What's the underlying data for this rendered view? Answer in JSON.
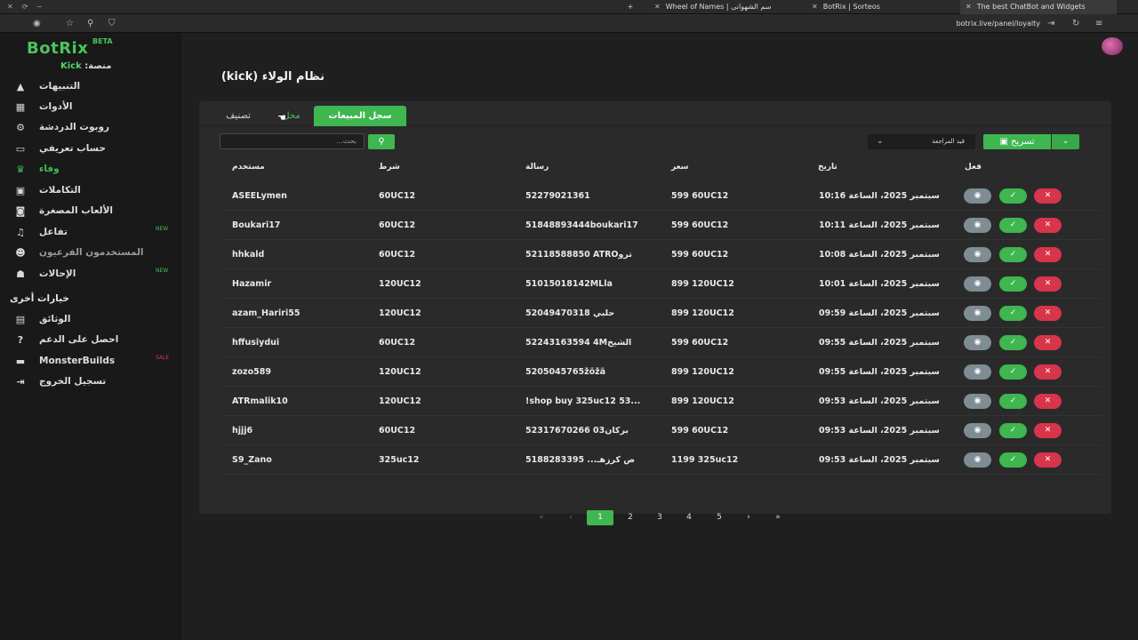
{
  "browser": {
    "tabs": [
      {
        "title": "The best ChatBot and Widgets",
        "active": true
      },
      {
        "title": "BotRix | Sorteos",
        "active": false
      },
      {
        "title": "Wheel of Names | سم الشهوانى",
        "active": false
      }
    ],
    "url": "botrix.live/panel/loyalty"
  },
  "sidebar": {
    "brand": "BotRix",
    "beta": "BETA",
    "platform_label": "منصة:",
    "platform_value": "Kick",
    "items": [
      {
        "label": "التنبيهات",
        "icon": "warning-icon"
      },
      {
        "label": "الأدوات",
        "icon": "tools-icon"
      },
      {
        "label": "روبوت الدردشة",
        "icon": "robot-icon"
      },
      {
        "label": "حساب تعريفي",
        "icon": "id-card-icon"
      },
      {
        "label": "وفاء",
        "icon": "trophy-icon"
      },
      {
        "label": "التكاملات",
        "icon": "integrations-icon"
      },
      {
        "label": "الألعاب المصغرة",
        "icon": "gamepad-icon"
      },
      {
        "label": "تفاعل",
        "icon": "music-icon",
        "badge": "NEW"
      },
      {
        "label": "المستخدمون الفرعيون",
        "icon": "users-icon"
      },
      {
        "label": "الإحالات",
        "icon": "referrals-icon",
        "badge": "NEW"
      }
    ],
    "other_title": "خيارات أخرى",
    "other_items": [
      {
        "label": "الوثائق",
        "icon": "docs-icon"
      },
      {
        "label": "احصل على الدعم",
        "icon": "help-icon"
      },
      {
        "label": "MonsterBuilds",
        "icon": "laptop-icon",
        "badge": "SALE"
      },
      {
        "label": "تسجيل الخروج",
        "icon": "logout-icon"
      }
    ]
  },
  "page": {
    "title": "نظام الولاء (kick)",
    "tabs": [
      "سجل المبيعات",
      "محل",
      "تصنيف"
    ],
    "search_placeholder": "بحث...",
    "filter_value": "قيد المراجعة",
    "export_label": "تسريح",
    "columns": {
      "user": "مستخدم",
      "condition": "شرط",
      "message": "رسالة",
      "price": "سعر",
      "date": "تاريخ",
      "action": "فعل"
    },
    "rows": [
      {
        "user": "ASEELymen",
        "condition": "60UC12",
        "message": "52279021361",
        "price": "599 60UC12",
        "date": "سبتمبر 2025، الساعة 10:16"
      },
      {
        "user": "Boukari17",
        "condition": "60UC12",
        "message": "51848893444boukari17",
        "price": "599 60UC12",
        "date": "سبتمبر 2025، الساعة 10:11"
      },
      {
        "user": "hhkald",
        "condition": "60UC12",
        "message": "52118588850 ATROترو",
        "price": "599 60UC12",
        "date": "سبتمبر 2025، الساعة 10:08"
      },
      {
        "user": "Hazamir",
        "condition": "120UC12",
        "message": "51015018142MLla",
        "price": "899 120UC12",
        "date": "سبتمبر 2025، الساعة 10:01"
      },
      {
        "user": "azam_Hariri55",
        "condition": "120UC12",
        "message": "52049470318 حلبي",
        "price": "899 120UC12",
        "date": "سبتمبر 2025، الساعة 09:59"
      },
      {
        "user": "hffusiydui",
        "condition": "60UC12",
        "message": "52243163594 4Mالشيخ",
        "price": "599 60UC12",
        "date": "سبتمبر 2025، الساعة 09:55"
      },
      {
        "user": "zozo589",
        "condition": "120UC12",
        "message": "5205045765žöžä",
        "price": "899 120UC12",
        "date": "سبتمبر 2025، الساعة 09:55"
      },
      {
        "user": "ATRmalik10",
        "condition": "120UC12",
        "message": "!shop buy 325uc12 53...",
        "price": "899 120UC12",
        "date": "سبتمبر 2025، الساعة 09:53"
      },
      {
        "user": "hjjj6",
        "condition": "60UC12",
        "message": "52317670266 03بركان",
        "price": "599 60UC12",
        "date": "سبتمبر 2025، الساعة 09:53"
      },
      {
        "user": "S9_Zano",
        "condition": "325uc12",
        "message": "5188283395 ...ص كرزهـ",
        "price": "1199 325uc12",
        "date": "سبتمبر 2025، الساعة 09:53"
      }
    ],
    "pagination": {
      "first": "«",
      "prev": "‹",
      "pages": [
        "1",
        "2",
        "3",
        "4",
        "5"
      ],
      "current": "1",
      "next": "›",
      "last": "»"
    }
  }
}
